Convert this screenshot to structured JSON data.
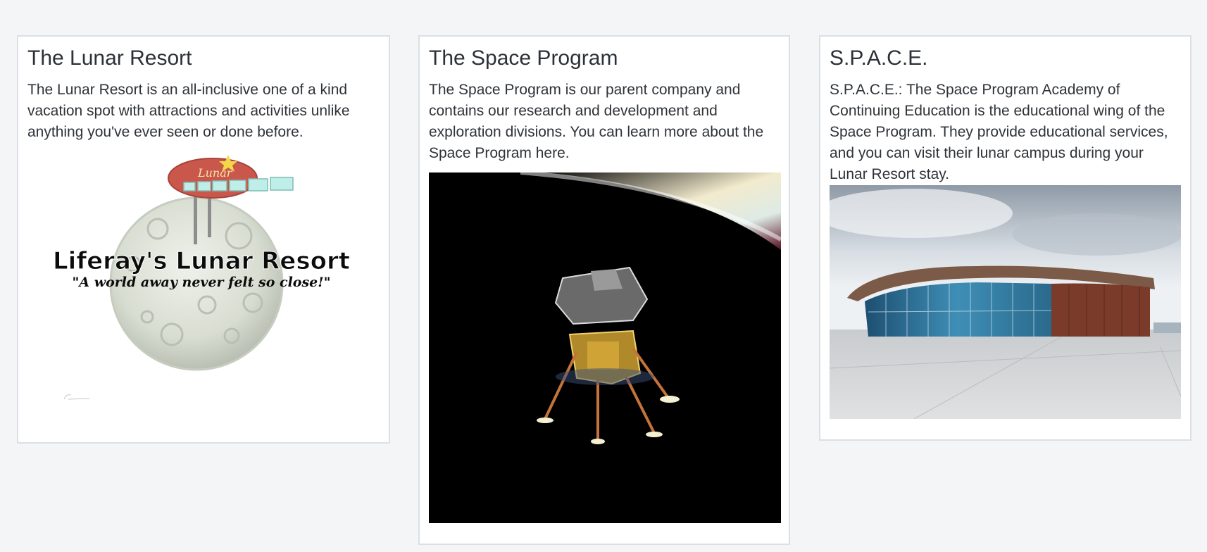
{
  "cards": [
    {
      "title": "The Lunar Resort",
      "body": "The Lunar Resort is an all-inclusive one of a kind vacation spot with attractions and activities unlike anything you've ever seen or done before.",
      "image": {
        "logo_script": "Lunar",
        "logo_main": "Liferay's Lunar Resort",
        "logo_tagline": "\"A world away never felt so close!\""
      }
    },
    {
      "title": "The Space Program",
      "body": "The Space Program is our parent company and contains our research and development and exploration divisions. You can learn more about the Space Program here.",
      "image": {
        "icon": "lunar-module-photo"
      }
    },
    {
      "title": "S.P.A.C.E.",
      "body": "S.P.A.C.E.: The Space Program Academy of Continuing Education is the educational wing of the Space Program. They provide educational services, and you can visit their lunar campus during your Lunar Resort stay.",
      "image": {
        "icon": "spaceport-building-photo"
      }
    }
  ]
}
